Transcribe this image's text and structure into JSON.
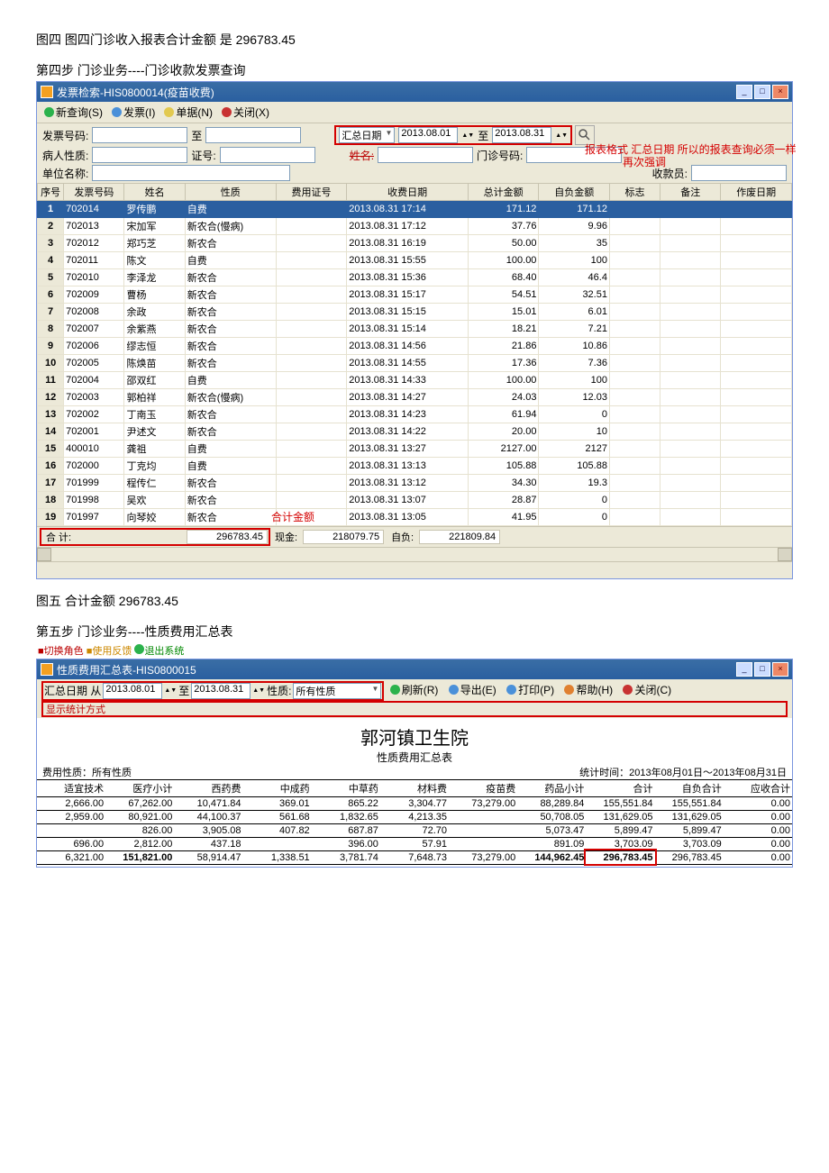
{
  "caption_fig4": "图四   图四门诊收入报表合计金额  是  296783.45",
  "step4": "第四步   门诊业务----门诊收款发票查询",
  "win1": {
    "title": "发票检索-HIS0800014(疫苗收费)",
    "toolbar": {
      "new_query": "新查询(S)",
      "invoice": "发票(I)",
      "bill": "单据(N)",
      "close": "关闭(X)"
    },
    "filters": {
      "invoice_label": "发票号码:",
      "to_label": "至",
      "date_type_label": "汇总日期",
      "date_from": "2013.08.01",
      "date_to": "2013.08.31",
      "patient_nature_label": "病人性质:",
      "cert_label": "证号:",
      "outpatient_no_label": "门诊号码:",
      "unit_label": "单位名称:",
      "name_label": "姓名:",
      "cashier_label": "收款员:"
    },
    "red_note1": "报表格式  汇总日期  所以的报表查询必须一样",
    "red_note2": "再次强调",
    "red_note3": "合计金额",
    "columns": [
      "序号",
      "发票号码",
      "姓名",
      "性质",
      "费用证号",
      "收费日期",
      "总计金额",
      "自负金额",
      "标志",
      "备注",
      "作废日期"
    ],
    "rows": [
      {
        "idx": 1,
        "inv": "702014",
        "name": "罗传鹏",
        "nat": "自费",
        "cert": "",
        "date": "2013.08.31 17:14",
        "tot": "171.12",
        "self": "171.12",
        "flag": "",
        "note": "",
        "void": ""
      },
      {
        "idx": 2,
        "inv": "702013",
        "name": "宋加军",
        "nat": "新农合(慢病)",
        "cert": "",
        "date": "2013.08.31 17:12",
        "tot": "37.76",
        "self": "9.96",
        "flag": "",
        "note": "",
        "void": ""
      },
      {
        "idx": 3,
        "inv": "702012",
        "name": "郑巧芝",
        "nat": "新农合",
        "cert": "",
        "date": "2013.08.31 16:19",
        "tot": "50.00",
        "self": "35",
        "flag": "",
        "note": "",
        "void": ""
      },
      {
        "idx": 4,
        "inv": "702011",
        "name": "陈文",
        "nat": "自费",
        "cert": "",
        "date": "2013.08.31 15:55",
        "tot": "100.00",
        "self": "100",
        "flag": "",
        "note": "",
        "void": ""
      },
      {
        "idx": 5,
        "inv": "702010",
        "name": "李泽龙",
        "nat": "新农合",
        "cert": "",
        "date": "2013.08.31 15:36",
        "tot": "68.40",
        "self": "46.4",
        "flag": "",
        "note": "",
        "void": ""
      },
      {
        "idx": 6,
        "inv": "702009",
        "name": "曹杨",
        "nat": "新农合",
        "cert": "",
        "date": "2013.08.31 15:17",
        "tot": "54.51",
        "self": "32.51",
        "flag": "",
        "note": "",
        "void": ""
      },
      {
        "idx": 7,
        "inv": "702008",
        "name": "余政",
        "nat": "新农合",
        "cert": "",
        "date": "2013.08.31 15:15",
        "tot": "15.01",
        "self": "6.01",
        "flag": "",
        "note": "",
        "void": ""
      },
      {
        "idx": 8,
        "inv": "702007",
        "name": "余紫燕",
        "nat": "新农合",
        "cert": "",
        "date": "2013.08.31 15:14",
        "tot": "18.21",
        "self": "7.21",
        "flag": "",
        "note": "",
        "void": ""
      },
      {
        "idx": 9,
        "inv": "702006",
        "name": "缪志恒",
        "nat": "新农合",
        "cert": "",
        "date": "2013.08.31 14:56",
        "tot": "21.86",
        "self": "10.86",
        "flag": "",
        "note": "",
        "void": ""
      },
      {
        "idx": 10,
        "inv": "702005",
        "name": "陈焕苗",
        "nat": "新农合",
        "cert": "",
        "date": "2013.08.31 14:55",
        "tot": "17.36",
        "self": "7.36",
        "flag": "",
        "note": "",
        "void": ""
      },
      {
        "idx": 11,
        "inv": "702004",
        "name": "邵双红",
        "nat": "自费",
        "cert": "",
        "date": "2013.08.31 14:33",
        "tot": "100.00",
        "self": "100",
        "flag": "",
        "note": "",
        "void": ""
      },
      {
        "idx": 12,
        "inv": "702003",
        "name": "郭柏祥",
        "nat": "新农合(慢病)",
        "cert": "",
        "date": "2013.08.31 14:27",
        "tot": "24.03",
        "self": "12.03",
        "flag": "",
        "note": "",
        "void": ""
      },
      {
        "idx": 13,
        "inv": "702002",
        "name": "丁南玉",
        "nat": "新农合",
        "cert": "",
        "date": "2013.08.31 14:23",
        "tot": "61.94",
        "self": "0",
        "flag": "",
        "note": "",
        "void": ""
      },
      {
        "idx": 14,
        "inv": "702001",
        "name": "尹述文",
        "nat": "新农合",
        "cert": "",
        "date": "2013.08.31 14:22",
        "tot": "20.00",
        "self": "10",
        "flag": "",
        "note": "",
        "void": ""
      },
      {
        "idx": 15,
        "inv": "400010",
        "name": "龚祖",
        "nat": "自费",
        "cert": "",
        "date": "2013.08.31 13:27",
        "tot": "2127.00",
        "self": "2127",
        "flag": "",
        "note": "",
        "void": ""
      },
      {
        "idx": 16,
        "inv": "702000",
        "name": "丁克均",
        "nat": "自费",
        "cert": "",
        "date": "2013.08.31 13:13",
        "tot": "105.88",
        "self": "105.88",
        "flag": "",
        "note": "",
        "void": ""
      },
      {
        "idx": 17,
        "inv": "701999",
        "name": "程传仁",
        "nat": "新农合",
        "cert": "",
        "date": "2013.08.31 13:12",
        "tot": "34.30",
        "self": "19.3",
        "flag": "",
        "note": "",
        "void": ""
      },
      {
        "idx": 18,
        "inv": "701998",
        "name": "吴欢",
        "nat": "新农合",
        "cert": "",
        "date": "2013.08.31 13:07",
        "tot": "28.87",
        "self": "0",
        "flag": "",
        "note": "",
        "void": ""
      },
      {
        "idx": 19,
        "inv": "701997",
        "name": "向琴姣",
        "nat": "新农合",
        "cert": "",
        "date": "2013.08.31 13:05",
        "tot": "41.95",
        "self": "0",
        "flag": "",
        "note": "",
        "void": ""
      }
    ],
    "totals": {
      "sum_label": "合            计:",
      "sum_value": "296783.45",
      "cash_label": "现金:",
      "cash_value": "218079.75",
      "self_label": "自负:",
      "self_value": "221809.84"
    }
  },
  "caption_fig5": "图五 合计金额  296783.45",
  "step5": "第五步   门诊业务----性质费用汇总表",
  "win2": {
    "menubar": {
      "switch_role": "切换角色",
      "feedback": "使用反馈",
      "exit": "退出系统"
    },
    "title": "性质费用汇总表-HIS0800015",
    "filters": {
      "date_label": "汇总日期  从",
      "date_from": "2013.08.01",
      "date_to_label": "至",
      "date_to": "2013.08.31",
      "nature_label": "性质:",
      "nature_value": "所有性质",
      "refresh": "刷新(R)",
      "export": "导出(E)",
      "print": "打印(P)",
      "help": "帮助(H)",
      "close": "关闭(C)",
      "display_mode_label": "显示统计方式"
    },
    "report": {
      "hospital": "郭河镇卫生院",
      "subtitle": "性质费用汇总表",
      "meta_left": "费用性质：所有性质",
      "meta_right": "统计时间：2013年08月01日～2013年08月31日",
      "columns": [
        "适宜技术",
        "医疗小计",
        "西药费",
        "中成药",
        "中草药",
        "材料费",
        "疫苗费",
        "药品小计",
        "合计",
        "自负合计",
        "应收合计"
      ],
      "rows": [
        [
          "2,666.00",
          "67,262.00",
          "10,471.84",
          "369.01",
          "865.22",
          "3,304.77",
          "73,279.00",
          "88,289.84",
          "155,551.84",
          "155,551.84",
          "0.00"
        ],
        [
          "2,959.00",
          "80,921.00",
          "44,100.37",
          "561.68",
          "1,832.65",
          "4,213.35",
          "",
          "50,708.05",
          "131,629.05",
          "131,629.05",
          "0.00"
        ],
        [
          "",
          "826.00",
          "3,905.08",
          "407.82",
          "687.87",
          "72.70",
          "",
          "5,073.47",
          "5,899.47",
          "5,899.47",
          "0.00"
        ],
        [
          "696.00",
          "2,812.00",
          "437.18",
          "",
          "396.00",
          "57.91",
          "",
          "891.09",
          "3,703.09",
          "3,703.09",
          "0.00"
        ],
        [
          "6,321.00",
          "151,821.00",
          "58,914.47",
          "1,338.51",
          "3,781.74",
          "7,648.73",
          "73,279.00",
          "144,962.45",
          "296,783.45",
          "296,783.45",
          "0.00"
        ]
      ]
    }
  }
}
